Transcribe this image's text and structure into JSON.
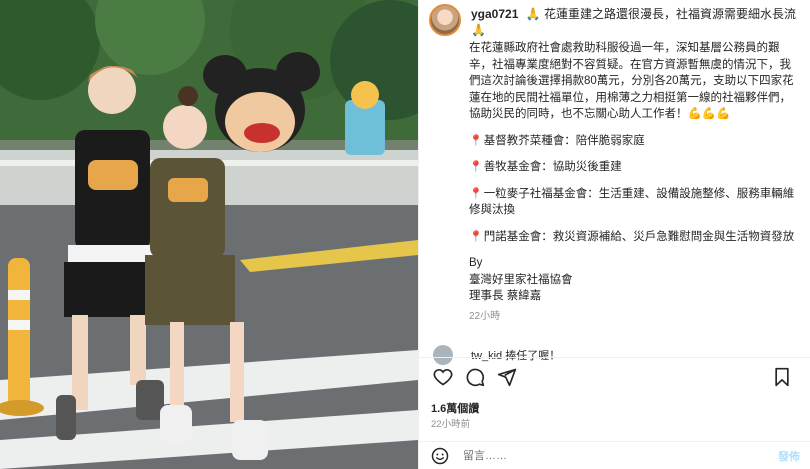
{
  "post": {
    "username": "yga0721",
    "title_line": "🙏 花蓮重建之路還很漫長，社福資源需要細水長流🙏",
    "paragraphs": [
      "在花蓮縣政府社會處救助科服役過一年，深知基層公務員的艱辛，社福專業度絕對不容質疑。在官方資源暫無虞的情況下，我們這次討論後選擇捐款80萬元，分別各20萬元，支助以下四家花蓮在地的民間社福單位，用棉薄之力相挺第一線的社福夥伴們，協助災民的同時，也不忘關心助人工作者！💪💪💪"
    ],
    "items": [
      "基督教芥菜種會：陪伴脆弱家庭",
      "善牧基金會：協助災後重建",
      "一粒麥子社福基金會：生活重建、設備設施整修、服務車輛維修與汰換",
      "門諾基金會：救災資源補給、災戶急難慰問金與生活物資發放"
    ],
    "signature": [
      "By",
      "臺灣好里家社福協會",
      "理事長 蔡緯嘉"
    ],
    "caption_time": "22小時",
    "peek_comment": "tw_kid 捧任了喔！",
    "likes": "1.6萬個讚",
    "post_time": "22小時前",
    "comment_placeholder": "留言……",
    "post_button": "發佈"
  },
  "icons": {
    "pin": "round-pushpin",
    "like": "heart-icon",
    "comment": "comment-icon",
    "share": "share-icon",
    "save": "bookmark-icon",
    "emoji": "emoji-icon"
  }
}
